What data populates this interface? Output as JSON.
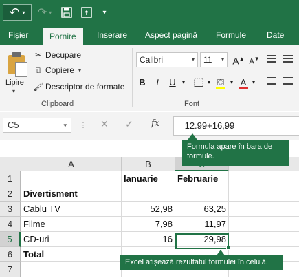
{
  "quick_access": {
    "icons": [
      "undo-icon",
      "redo-icon",
      "save-icon",
      "touch-mode-icon",
      "customize-icon"
    ]
  },
  "tabs": [
    "Fișier",
    "Pornire",
    "Inserare",
    "Aspect pagină",
    "Formule",
    "Date"
  ],
  "active_tab": "Pornire",
  "ribbon": {
    "clipboard": {
      "paste": "Lipire",
      "cut": "Decupare",
      "copy": "Copiere",
      "format_painter": "Descriptor de formate",
      "group_label": "Clipboard"
    },
    "font": {
      "font_name": "Calibri",
      "font_size": "11",
      "bold": "B",
      "italic": "I",
      "underline": "U",
      "group_label": "Font"
    }
  },
  "formula_bar": {
    "name_box": "C5",
    "formula": "=12.99+16,99"
  },
  "callouts": {
    "formula": "Formula apare în bara de formule.",
    "result": "Excel afișează rezultatul formulei în celulă."
  },
  "sheet": {
    "columns": [
      "A",
      "B",
      "C"
    ],
    "rows": [
      "1",
      "2",
      "3",
      "4",
      "5",
      "6",
      "7"
    ],
    "cells": {
      "B1": "Ianuarie",
      "C1": "Februarie",
      "A2": "Divertisment",
      "A3": "Cablu TV",
      "B3": "52,98",
      "C3": "63,25",
      "A4": "Filme",
      "B4": "7,98",
      "C4": "11,97",
      "A5": "CD-uri",
      "B5": "16",
      "C5": "29,98",
      "A6": "Total"
    },
    "active_cell": "C5"
  },
  "colors": {
    "accent": "#217346"
  }
}
